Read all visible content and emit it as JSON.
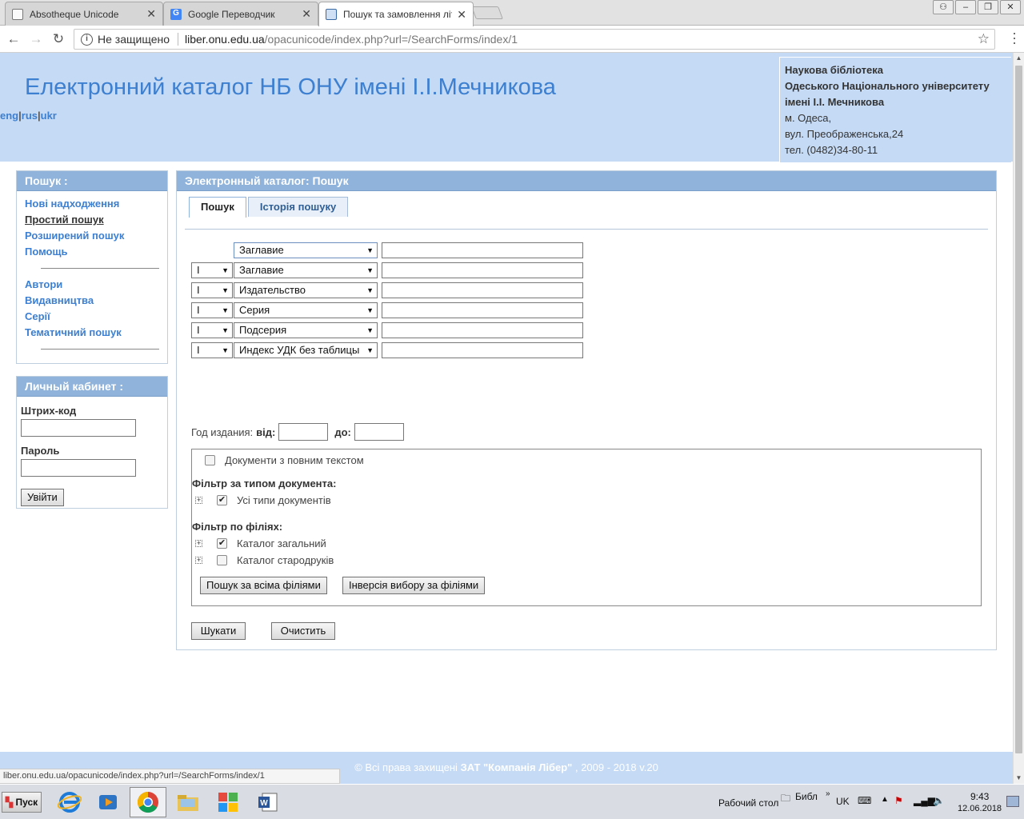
{
  "browser": {
    "tabs": [
      {
        "label": "Absotheque Unicode"
      },
      {
        "label": "Google Переводчик"
      },
      {
        "label": "Пошук та замовлення літе"
      }
    ],
    "address": {
      "security": "Не защищено",
      "host": "liber.onu.edu.ua",
      "path": "/opacunicode/index.php?url=/SearchForms/index/1"
    },
    "status_url": "liber.onu.edu.ua/opacunicode/index.php?url=/SearchForms/index/1"
  },
  "header": {
    "title": "Електронний каталог НБ ОНУ імені І.І.Мечникова",
    "langs": [
      "eng",
      "rus",
      "ukr"
    ],
    "lang_sep": "|",
    "contact": {
      "line1": "Наукова бібліотека",
      "line2": "Одеського Національного університету",
      "line3": "імені І.І. Мечникова",
      "line4": "м. Одеса,",
      "line5": "вул. Преображенська,24",
      "line6": "тел. (0482)34-80-11"
    }
  },
  "sidebar": {
    "search_title": "Пошук :",
    "search_links": [
      "Нові надходження",
      "Простий пошук",
      "Розширений пошук",
      "Помощь"
    ],
    "catalog_links": [
      "Автори",
      "Видавництва",
      "Серії",
      "Тематичний пошук"
    ],
    "cabinet_title": "Личный кабинет :",
    "barcode_label": "Штрих-код",
    "password_label": "Пароль",
    "login_button": "Увійти"
  },
  "main": {
    "title": "Электронный каталог: Пошук",
    "tabs": [
      "Пошук",
      "Історія пошуку"
    ],
    "rows": [
      {
        "op": "",
        "field": "Заглавие"
      },
      {
        "op": "І",
        "field": "Заглавие"
      },
      {
        "op": "І",
        "field": "Издательство"
      },
      {
        "op": "І",
        "field": "Серия"
      },
      {
        "op": "І",
        "field": "Подсерия"
      },
      {
        "op": "І",
        "field": "Индекс УДК без таблицы"
      }
    ],
    "year_label": "Год издания:",
    "year_from": "від:",
    "year_to": "до:",
    "fulltext_label": "Документи з повним текстом",
    "doctype_title": "Фільтр за типом документа:",
    "doctype_item": "Усі типи документів",
    "branch_title": "Фільтр по філіях:",
    "branches": [
      {
        "label": "Каталог загальний",
        "checked": true
      },
      {
        "label": "Каталог стародруків",
        "checked": false
      }
    ],
    "btn_all_branches": "Пошук за всіма філіями",
    "btn_invert": "Інверсія вибору за філіями",
    "btn_search": "Шукати",
    "btn_clear": "Очистить"
  },
  "footer": {
    "prefix": "© Всі права захищені",
    "company": "ЗАТ \"Компанія Лібер\"",
    "suffix": ", 2009 - 2018  v.20"
  },
  "taskbar": {
    "start": "Пуск",
    "desktop": "Рабочий стол",
    "bibl": "Библ",
    "lang": "UK",
    "time": "9:43",
    "date": "12.06.2018"
  },
  "colors": {
    "header_bg": "#c5daf5",
    "accent": "#3d7fd0",
    "panel_head": "#8fb3da"
  }
}
